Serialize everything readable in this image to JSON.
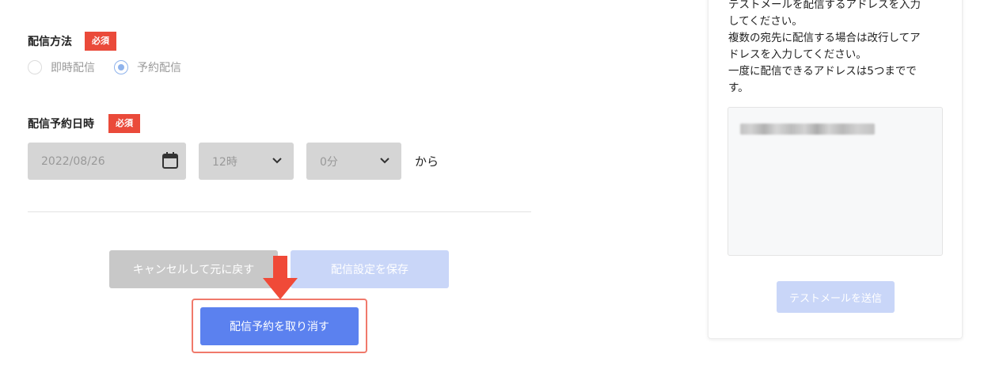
{
  "delivery_method": {
    "label": "配信方法",
    "required_badge": "必須",
    "options": [
      {
        "label": "即時配信",
        "selected": false
      },
      {
        "label": "予約配信",
        "selected": true
      }
    ]
  },
  "schedule": {
    "label": "配信予約日時",
    "required_badge": "必須",
    "date_value": "2022/08/26",
    "hour_value": "12時",
    "minute_value": "0分",
    "suffix": "から"
  },
  "actions": {
    "cancel_label": "キャンセルして元に戻す",
    "save_label": "配信設定を保存",
    "revoke_label": "配信予約を取り消す"
  },
  "test_mail": {
    "help_lines": [
      "テストメールを配信するアドレスを入力",
      "してください。",
      "複数の宛先に配信する場合は改行してア",
      "ドレスを入力してください。",
      "一度に配信できるアドレスは5つまでで",
      "す。"
    ],
    "send_label": "テストメールを送信"
  },
  "colors": {
    "required_badge": "#ea4a3a",
    "primary": "#5b81ef",
    "primary_disabled": "#c9d6f8",
    "highlight": "#f0796b",
    "arrow": "#f04a38"
  },
  "icons": [
    "calendar-icon",
    "chevron-down-icon",
    "down-arrow-icon"
  ]
}
